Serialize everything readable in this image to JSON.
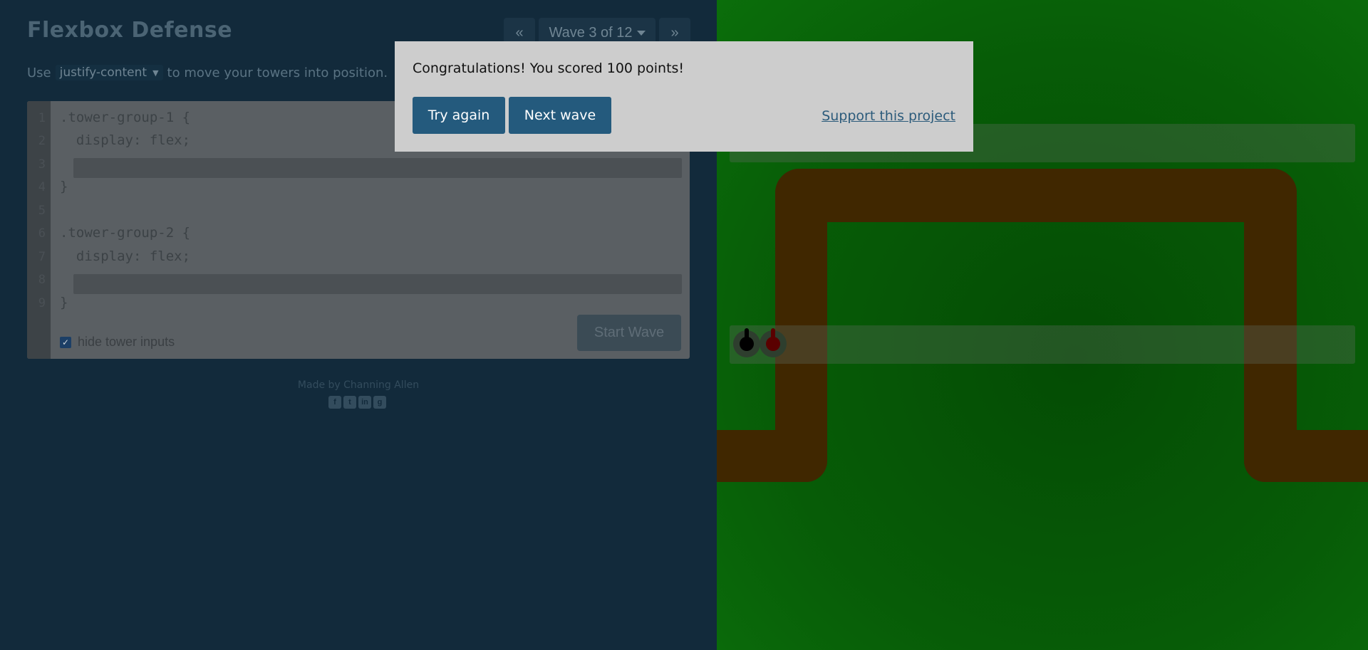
{
  "app": {
    "title": "Flexbox Defense"
  },
  "wave_nav": {
    "prev_label": "«",
    "current_label": "Wave 3 of 12",
    "next_label": "»"
  },
  "instructions": {
    "prefix": "Use",
    "property": "justify-content",
    "property_caret": "▼",
    "suffix": "to move your towers into position."
  },
  "editor": {
    "line_numbers": [
      "1",
      "2",
      "3",
      "4",
      "5",
      "6",
      "7",
      "8",
      "9"
    ],
    "lines": [
      ".tower-group-1 {",
      "  display: flex;",
      "",
      "}",
      "",
      ".tower-group-2 {",
      "  display: flex;",
      "",
      "}"
    ],
    "hide_inputs_label": "hide tower inputs",
    "hide_inputs_checked": true,
    "start_button": "Start Wave"
  },
  "footer": {
    "credit": "Made by Channing Allen",
    "social_icons": [
      "facebook-icon",
      "twitter-icon",
      "linkedin-icon",
      "github-icon"
    ]
  },
  "modal": {
    "message": "Congratulations! You scored 100 points!",
    "try_again": "Try again",
    "next_wave": "Next wave",
    "support": "Support this project"
  },
  "board": {
    "towers": [
      {
        "group": 1,
        "color": "#3a3030"
      },
      {
        "group": 2,
        "color": "#000000"
      },
      {
        "group": 2,
        "color": "#5a0000"
      }
    ]
  },
  "colors": {
    "accent": "#245a7d",
    "board_green": "#075c07",
    "track_brown": "#402700"
  }
}
